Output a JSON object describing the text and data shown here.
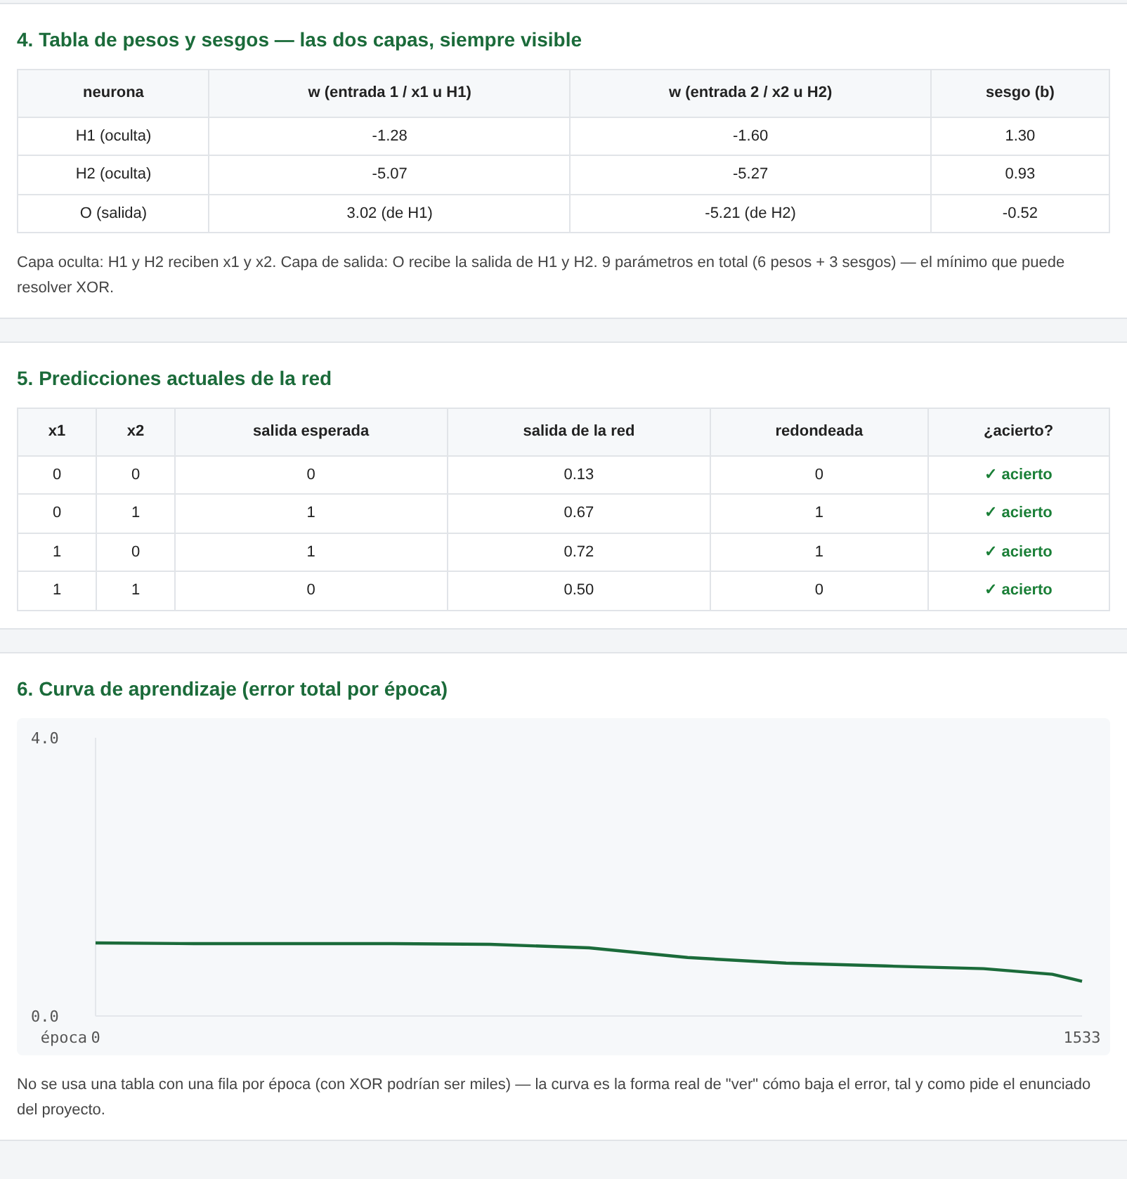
{
  "sections": [
    {
      "kind": "table",
      "title": "4. Tabla de pesos y sesgos — las dos capas, siempre visible",
      "columns": [
        "neurona",
        "w (entrada 1 / x1 u H1)",
        "w (entrada 2 / x2 u H2)",
        "sesgo (b)"
      ],
      "rows": [
        [
          "H1 (oculta)",
          "-1.28",
          "-1.60",
          "1.30"
        ],
        [
          "H2 (oculta)",
          "-5.07",
          "-5.27",
          "0.93"
        ],
        [
          "O (salida)",
          "3.02 (de H1)",
          "-5.21 (de H2)",
          "-0.52"
        ]
      ],
      "note": "Capa oculta: H1 y H2 reciben x1 y x2. Capa de salida: O recibe la salida de H1 y H2. 9 parámetros en total (6 pesos + 3 sesgos) — el mínimo que puede resolver XOR."
    },
    {
      "kind": "predictions",
      "title": "5. Predicciones actuales de la red",
      "columns": [
        "x1",
        "x2",
        "salida esperada",
        "salida de la red",
        "redondeada",
        "¿acierto?"
      ],
      "rows": [
        {
          "cells": [
            "0",
            "0",
            "0",
            "0.13",
            "0"
          ],
          "result": "✓ acierto",
          "correct": true
        },
        {
          "cells": [
            "0",
            "1",
            "1",
            "0.67",
            "1"
          ],
          "result": "✓ acierto",
          "correct": true
        },
        {
          "cells": [
            "1",
            "0",
            "1",
            "0.72",
            "1"
          ],
          "result": "✓ acierto",
          "correct": true
        },
        {
          "cells": [
            "1",
            "1",
            "0",
            "0.50",
            "0"
          ],
          "result": "✓ acierto",
          "correct": true
        }
      ]
    },
    {
      "kind": "chart",
      "title": "6. Curva de aprendizaje (error total por época)",
      "chart_data": {
        "type": "line",
        "x": [
          0,
          153,
          307,
          460,
          613,
          767,
          920,
          1073,
          1227,
          1380,
          1487,
          1533
        ],
        "series": [
          {
            "color": "#1b6b3a",
            "values": [
              1.05,
              1.04,
              1.04,
              1.04,
              1.03,
              0.98,
              0.84,
              0.76,
              0.72,
              0.68,
              0.6,
              0.5
            ]
          }
        ],
        "xlim": [
          0,
          1533
        ],
        "ylim": [
          0,
          4
        ],
        "xlabel": "época",
        "xticks": [
          0,
          1533
        ],
        "yticks": [
          {
            "value": 0,
            "label": "0.0"
          },
          {
            "value": 4,
            "label": "4.0"
          }
        ]
      },
      "note": "No se usa una tabla con una fila por época (con XOR podrían ser miles) — la curva es la forma real de \"ver\" cómo baja el error, tal y como pide el enunciado del proyecto."
    }
  ]
}
